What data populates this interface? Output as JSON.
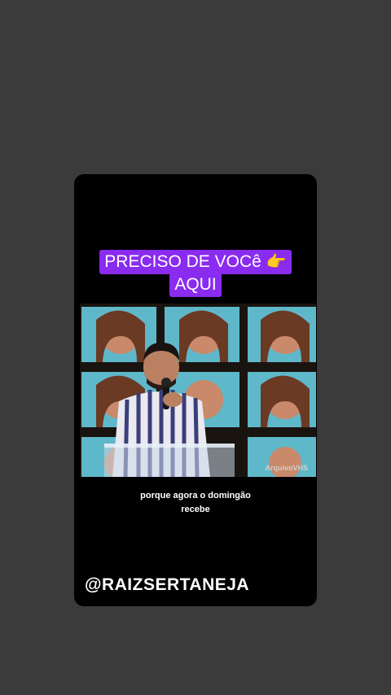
{
  "caption": {
    "line1": "PRECISO DE VOCê",
    "line2": "AQUI",
    "emoji": "👉"
  },
  "video": {
    "watermark": "ArquivoVHS"
  },
  "subtitle": {
    "line1": "porque agora o domingão",
    "line2": "recebe"
  },
  "handle": "@RAIZSERTANEJA",
  "colors": {
    "background": "#3b3b3b",
    "card": "#000000",
    "caption_bg": "#8a2bf0",
    "text": "#ffffff"
  }
}
